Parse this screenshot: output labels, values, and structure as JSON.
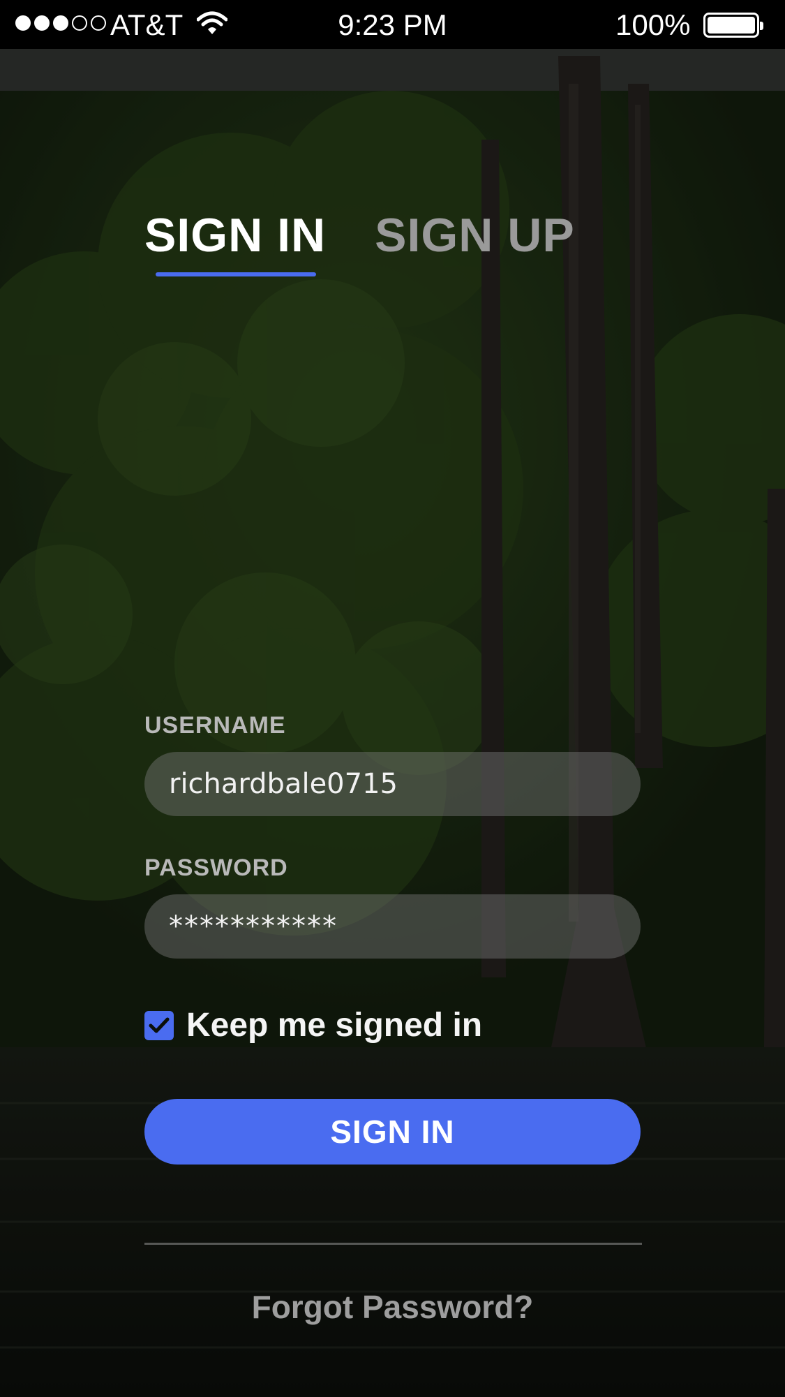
{
  "status_bar": {
    "signal_dots_filled": 3,
    "signal_dots_total": 5,
    "carrier": "AT&T",
    "time": "9:23 PM",
    "battery_percent": "100%",
    "battery_level": 1.0,
    "icons": [
      "signal-icon",
      "wifi-icon",
      "battery-icon"
    ]
  },
  "tabs": [
    {
      "label": "SIGN IN",
      "active": true
    },
    {
      "label": "SIGN UP",
      "active": false
    }
  ],
  "form": {
    "username": {
      "label": "USERNAME",
      "value": "richardbale0715"
    },
    "password": {
      "label": "PASSWORD",
      "value": "***********"
    },
    "keep_signed_in": {
      "label": "Keep me signed in",
      "checked": true
    },
    "submit_label": "SIGN IN",
    "forgot_label": "Forgot Password?"
  },
  "colors": {
    "accent": "#4a6cf0",
    "inactive_tab": "#9a9a9a",
    "field_background": "rgba(120,120,120,0.45)"
  }
}
